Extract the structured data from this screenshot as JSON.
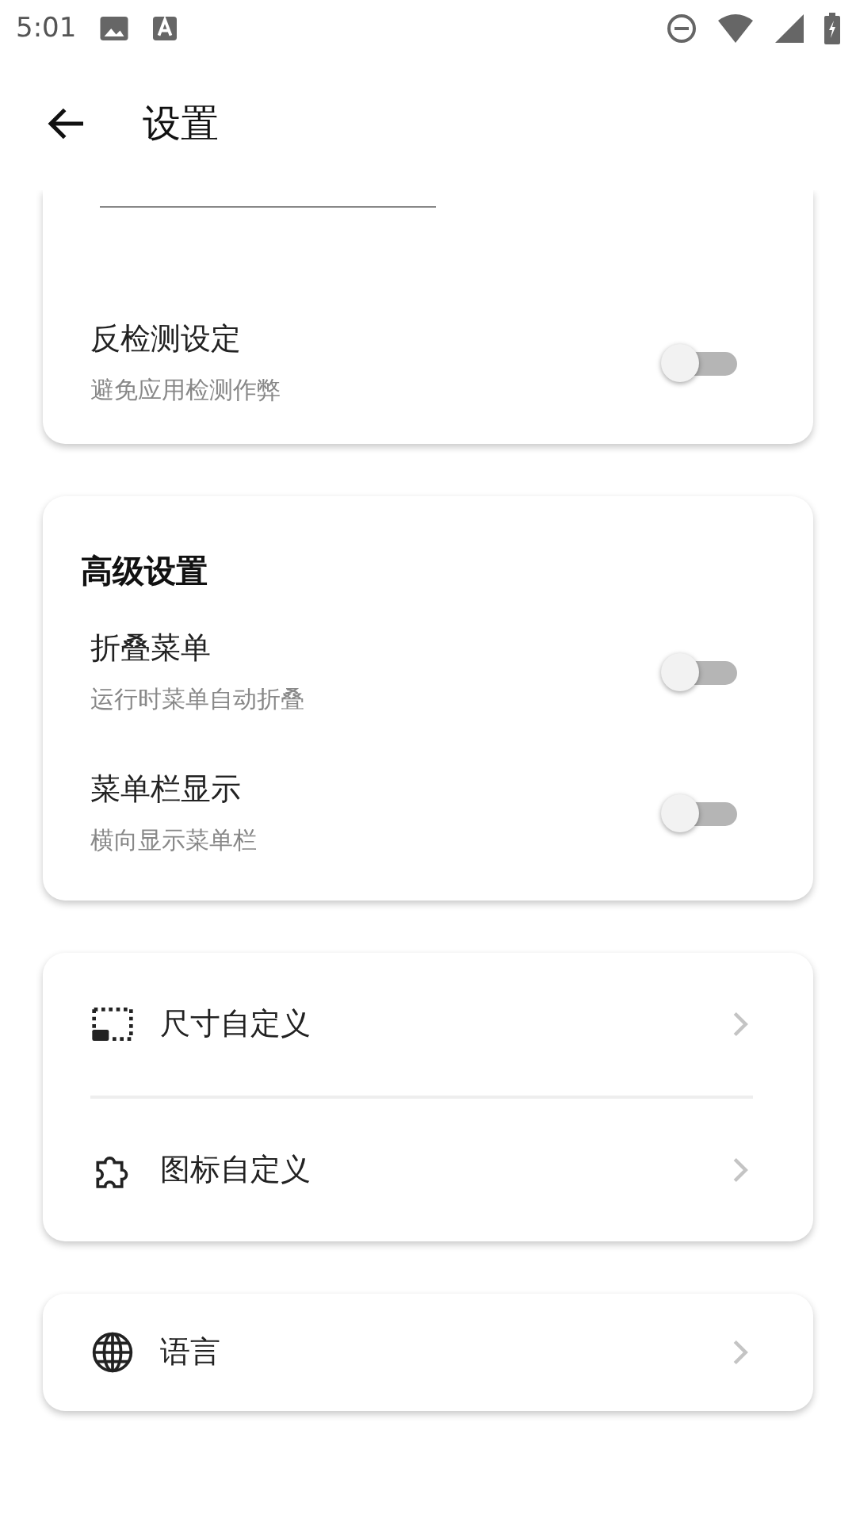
{
  "status_bar": {
    "time": "5:01"
  },
  "app_bar": {
    "title": "设置"
  },
  "anti_detect": {
    "title": "反检测设定",
    "subtitle": "避免应用检测作弊",
    "checked": false
  },
  "advanced": {
    "heading": "高级设置",
    "rows": [
      {
        "title": "折叠菜单",
        "subtitle": "运行时菜单自动折叠",
        "checked": false
      },
      {
        "title": "菜单栏显示",
        "subtitle": "横向显示菜单栏",
        "checked": false
      }
    ]
  },
  "custom": [
    {
      "kind": "size",
      "label": "尺寸自定义"
    },
    {
      "kind": "icon",
      "label": "图标自定义"
    }
  ],
  "language": {
    "label": "语言"
  }
}
